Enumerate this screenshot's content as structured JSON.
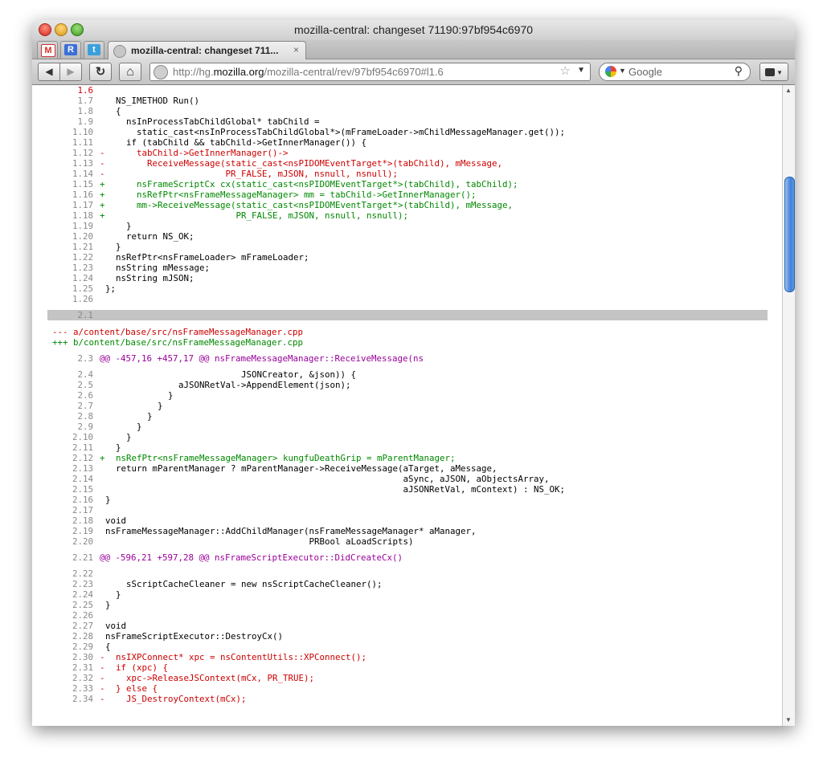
{
  "window": {
    "title": "mozilla-central: changeset 71190:97bf954c6970"
  },
  "tabs": {
    "pinned": [
      {
        "name": "gmail-tab-icon",
        "glyph": "M",
        "color": "#d93025"
      },
      {
        "name": "google-reader-tab-icon",
        "glyph": "R",
        "color": "#3b6fd8"
      },
      {
        "name": "twitter-tab-icon",
        "glyph": "t",
        "color": "#3aa0dc"
      }
    ],
    "active": {
      "label": "mozilla-central: changeset 711...",
      "close": "×"
    }
  },
  "nav": {
    "back": "◀",
    "forward": "▶",
    "reload": "↻",
    "home": "⌂",
    "url_prefix": "http://hg.",
    "url_domain": "mozilla.org",
    "url_suffix": "/mozilla-central/rev/97bf954c6970#l1.6",
    "star": "☆",
    "search_placeholder": "Google",
    "search_icon": "⚲"
  },
  "code_lines": [
    {
      "ln": "1.6",
      "mk": "",
      "t": "",
      "c": "ctx",
      "lnc": "#cc0000"
    },
    {
      "ln": "1.7",
      "mk": "",
      "t": "  NS_IMETHOD Run()",
      "c": "ctx"
    },
    {
      "ln": "1.8",
      "mk": "",
      "t": "  {",
      "c": "ctx"
    },
    {
      "ln": "1.9",
      "mk": "",
      "t": "    nsInProcessTabChildGlobal* tabChild =",
      "c": "ctx"
    },
    {
      "ln": "1.10",
      "mk": "",
      "t": "      static_cast<nsInProcessTabChildGlobal*>(mFrameLoader->mChildMessageManager.get());",
      "c": "ctx"
    },
    {
      "ln": "1.11",
      "mk": "",
      "t": "    if (tabChild && tabChild->GetInnerManager()) {",
      "c": "ctx"
    },
    {
      "ln": "1.12",
      "mk": "-",
      "t": "      tabChild->GetInnerManager()->",
      "c": "del"
    },
    {
      "ln": "1.13",
      "mk": "-",
      "t": "        ReceiveMessage(static_cast<nsPIDOMEventTarget*>(tabChild), mMessage,",
      "c": "del"
    },
    {
      "ln": "1.14",
      "mk": "-",
      "t": "                       PR_FALSE, mJSON, nsnull, nsnull);",
      "c": "del"
    },
    {
      "ln": "1.15",
      "mk": "+",
      "t": "      nsFrameScriptCx cx(static_cast<nsPIDOMEventTarget*>(tabChild), tabChild);",
      "c": "add"
    },
    {
      "ln": "1.16",
      "mk": "+",
      "t": "      nsRefPtr<nsFrameMessageManager> mm = tabChild->GetInnerManager();",
      "c": "add"
    },
    {
      "ln": "1.17",
      "mk": "+",
      "t": "      mm->ReceiveMessage(static_cast<nsPIDOMEventTarget*>(tabChild), mMessage,",
      "c": "add"
    },
    {
      "ln": "1.18",
      "mk": "+",
      "t": "                         PR_FALSE, mJSON, nsnull, nsnull);",
      "c": "add"
    },
    {
      "ln": "1.19",
      "mk": "",
      "t": "    }",
      "c": "ctx"
    },
    {
      "ln": "1.20",
      "mk": "",
      "t": "    return NS_OK;",
      "c": "ctx"
    },
    {
      "ln": "1.21",
      "mk": "",
      "t": "  }",
      "c": "ctx"
    },
    {
      "ln": "1.22",
      "mk": "",
      "t": "  nsRefPtr<nsFrameLoader> mFrameLoader;",
      "c": "ctx"
    },
    {
      "ln": "1.23",
      "mk": "",
      "t": "  nsString mMessage;",
      "c": "ctx"
    },
    {
      "ln": "1.24",
      "mk": "",
      "t": "  nsString mJSON;",
      "c": "ctx"
    },
    {
      "ln": "1.25",
      "mk": "",
      "t": "};",
      "c": "ctx"
    },
    {
      "ln": "1.26",
      "mk": "",
      "t": "",
      "c": "ctx"
    },
    {
      "ln": "",
      "mk": "",
      "t": "",
      "c": "gap"
    },
    {
      "ln": "2.1",
      "mk": "",
      "t": "",
      "c": "sep"
    },
    {
      "ln": "",
      "mk": "",
      "t": "",
      "c": "gap"
    },
    {
      "ln": "",
      "mk": "",
      "t": "--- a/content/base/src/nsFrameMessageManager.cpp",
      "c": "hdel"
    },
    {
      "ln": "",
      "mk": "",
      "t": "+++ b/content/base/src/nsFrameMessageManager.cpp",
      "c": "hadd"
    },
    {
      "ln": "",
      "mk": "",
      "t": "",
      "c": "gap"
    },
    {
      "ln": "2.3",
      "mk": "",
      "t": "@@ -457,16 +457,17 @@ nsFrameMessageManager::ReceiveMessage(ns",
      "c": "hunk"
    },
    {
      "ln": "",
      "mk": "",
      "t": "",
      "c": "gap"
    },
    {
      "ln": "2.4",
      "mk": "",
      "t": "                          JSONCreator, &json)) {",
      "c": "ctx"
    },
    {
      "ln": "2.5",
      "mk": "",
      "t": "              aJSONRetVal->AppendElement(json);",
      "c": "ctx"
    },
    {
      "ln": "2.6",
      "mk": "",
      "t": "            }",
      "c": "ctx"
    },
    {
      "ln": "2.7",
      "mk": "",
      "t": "          }",
      "c": "ctx"
    },
    {
      "ln": "2.8",
      "mk": "",
      "t": "        }",
      "c": "ctx"
    },
    {
      "ln": "2.9",
      "mk": "",
      "t": "      }",
      "c": "ctx"
    },
    {
      "ln": "2.10",
      "mk": "",
      "t": "    }",
      "c": "ctx"
    },
    {
      "ln": "2.11",
      "mk": "",
      "t": "  }",
      "c": "ctx"
    },
    {
      "ln": "2.12",
      "mk": "+",
      "t": "  nsRefPtr<nsFrameMessageManager> kungfuDeathGrip = mParentManager;",
      "c": "add"
    },
    {
      "ln": "2.13",
      "mk": "",
      "t": "  return mParentManager ? mParentManager->ReceiveMessage(aTarget, aMessage,",
      "c": "ctx"
    },
    {
      "ln": "2.14",
      "mk": "",
      "t": "                                                         aSync, aJSON, aObjectsArray,",
      "c": "ctx"
    },
    {
      "ln": "2.15",
      "mk": "",
      "t": "                                                         aJSONRetVal, mContext) : NS_OK;",
      "c": "ctx"
    },
    {
      "ln": "2.16",
      "mk": "",
      "t": "}",
      "c": "ctx"
    },
    {
      "ln": "2.17",
      "mk": "",
      "t": "",
      "c": "ctx"
    },
    {
      "ln": "2.18",
      "mk": "",
      "t": "void",
      "c": "ctx"
    },
    {
      "ln": "2.19",
      "mk": "",
      "t": "nsFrameMessageManager::AddChildManager(nsFrameMessageManager* aManager,",
      "c": "ctx"
    },
    {
      "ln": "2.20",
      "mk": "",
      "t": "                                       PRBool aLoadScripts)",
      "c": "ctx"
    },
    {
      "ln": "",
      "mk": "",
      "t": "",
      "c": "gap"
    },
    {
      "ln": "2.21",
      "mk": "",
      "t": "@@ -596,21 +597,28 @@ nsFrameScriptExecutor::DidCreateCx()",
      "c": "hunk"
    },
    {
      "ln": "",
      "mk": "",
      "t": "",
      "c": "gap"
    },
    {
      "ln": "2.22",
      "mk": "",
      "t": "",
      "c": "ctx"
    },
    {
      "ln": "2.23",
      "mk": "",
      "t": "    sScriptCacheCleaner = new nsScriptCacheCleaner();",
      "c": "ctx"
    },
    {
      "ln": "2.24",
      "mk": "",
      "t": "  }",
      "c": "ctx"
    },
    {
      "ln": "2.25",
      "mk": "",
      "t": "}",
      "c": "ctx"
    },
    {
      "ln": "2.26",
      "mk": "",
      "t": "",
      "c": "ctx"
    },
    {
      "ln": "2.27",
      "mk": "",
      "t": "void",
      "c": "ctx"
    },
    {
      "ln": "2.28",
      "mk": "",
      "t": "nsFrameScriptExecutor::DestroyCx()",
      "c": "ctx"
    },
    {
      "ln": "2.29",
      "mk": "",
      "t": "{",
      "c": "ctx"
    },
    {
      "ln": "2.30",
      "mk": "-",
      "t": "  nsIXPConnect* xpc = nsContentUtils::XPConnect();",
      "c": "del"
    },
    {
      "ln": "2.31",
      "mk": "-",
      "t": "  if (xpc) {",
      "c": "del"
    },
    {
      "ln": "2.32",
      "mk": "-",
      "t": "    xpc->ReleaseJSContext(mCx, PR_TRUE);",
      "c": "del"
    },
    {
      "ln": "2.33",
      "mk": "-",
      "t": "  } else {",
      "c": "del"
    },
    {
      "ln": "2.34",
      "mk": "-",
      "t": "    JS_DestroyContext(mCx);",
      "c": "del"
    }
  ]
}
